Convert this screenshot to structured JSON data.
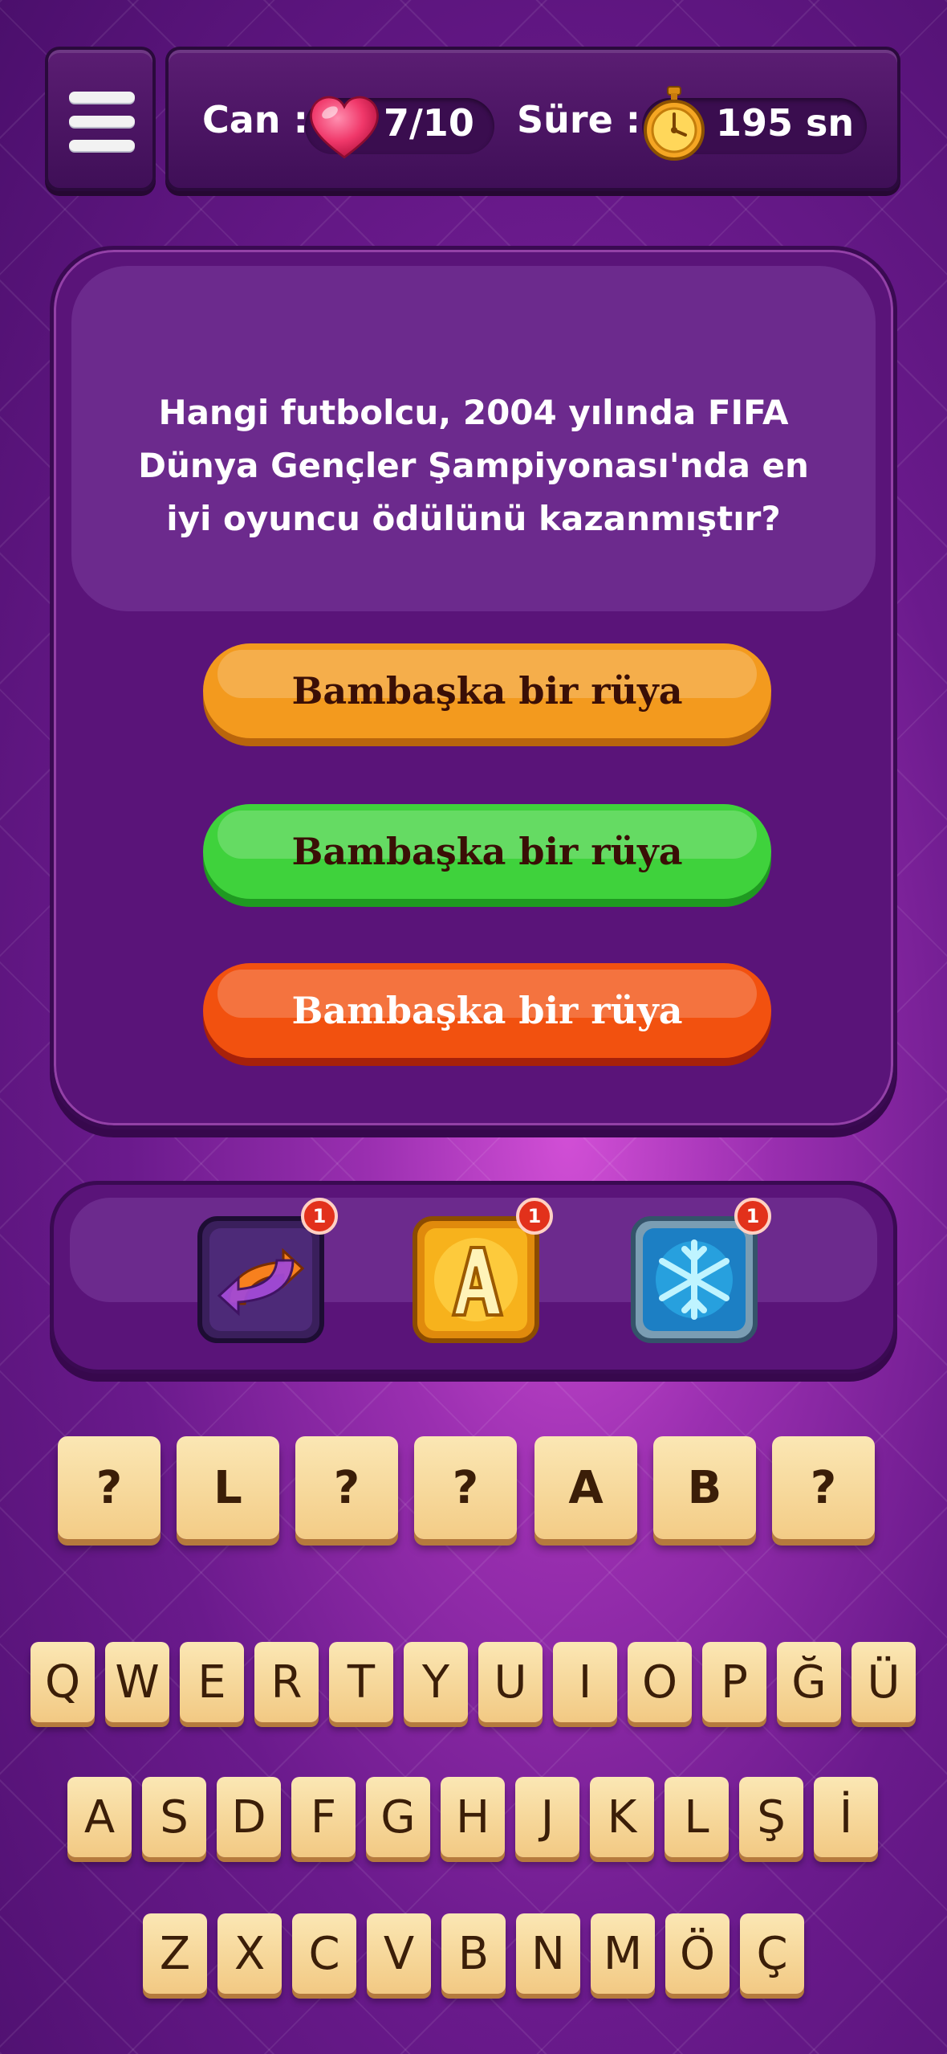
{
  "header": {
    "lives_label": "Can :",
    "lives_value": "7/10",
    "time_label": "Süre :",
    "time_value": "195 sn"
  },
  "question": {
    "text": "Hangi futbolcu, 2004 yılında FIFA Dünya Gençler Şampiyonası'nda en iyi oyuncu ödülünü kazanmıştır?"
  },
  "answers": [
    {
      "label": "Bambaşka bir rüya",
      "color": "#f39a1e"
    },
    {
      "label": "Bambaşka bir rüya",
      "color": "#3fd23c"
    },
    {
      "label": "Bambaşka bir rüya",
      "color": "#f2510f"
    }
  ],
  "powerups": [
    {
      "name": "swap-icon",
      "count": "1"
    },
    {
      "name": "letter-a-icon",
      "count": "1"
    },
    {
      "name": "snowflake-icon",
      "count": "1"
    }
  ],
  "answer_tiles": [
    "?",
    "L",
    "?",
    "?",
    "A",
    "B",
    "?"
  ],
  "keyboard": {
    "row1": [
      "Q",
      "W",
      "E",
      "R",
      "T",
      "Y",
      "U",
      "I",
      "O",
      "P",
      "Ğ",
      "Ü"
    ],
    "row2": [
      "A",
      "S",
      "D",
      "F",
      "G",
      "H",
      "J",
      "K",
      "L",
      "Ş",
      "İ"
    ],
    "row3": [
      "Z",
      "X",
      "C",
      "V",
      "B",
      "N",
      "M",
      "Ö",
      "Ç"
    ]
  }
}
